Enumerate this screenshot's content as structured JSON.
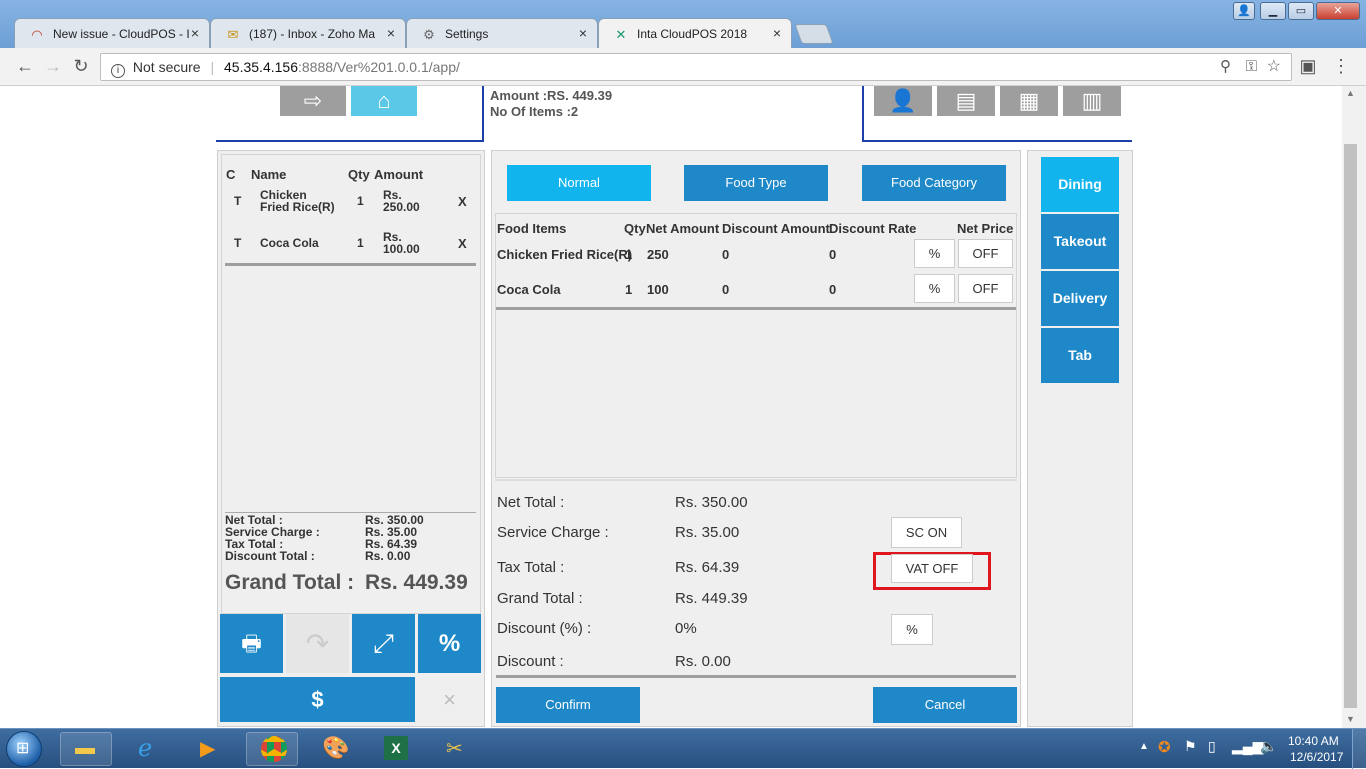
{
  "browser": {
    "tabs": [
      {
        "title": "New issue - CloudPOS - I",
        "icon": "cloudpos-icon"
      },
      {
        "title": "(187) - Inbox - Zoho Ma",
        "icon": "mail-icon"
      },
      {
        "title": "Settings",
        "icon": "gear-icon"
      },
      {
        "title": "Inta CloudPOS 2018",
        "icon": "inta-icon"
      }
    ],
    "security": "Not secure",
    "url_host": "45.35.4.156",
    "url_rest": ":8888/Ver%201.0.0.1/app/"
  },
  "header": {
    "amount": "Amount :RS. 449.39",
    "items": "No Of Items :2"
  },
  "order": {
    "headers": {
      "c": "C",
      "name": "Name",
      "qty": "Qty",
      "amount": "Amount"
    },
    "rows": [
      {
        "c": "T",
        "name1": "Chicken",
        "name2": "Fried Rice(R)",
        "qty": "1",
        "amt1": "Rs.",
        "amt2": "250.00",
        "x": "X"
      },
      {
        "c": "T",
        "name1": "Coca Cola",
        "name2": "",
        "qty": "1",
        "amt1": "Rs.",
        "amt2": "100.00",
        "x": "X"
      }
    ],
    "totals": {
      "net_label": "Net Total :",
      "net_value": "Rs. 350.00",
      "svc_label": "Service Charge :",
      "svc_value": "Rs. 35.00",
      "tax_label": "Tax Total :",
      "tax_value": "Rs. 64.39",
      "disc_label": "Discount Total :",
      "disc_value": "Rs. 0.00",
      "grand_label": "Grand Total :",
      "grand_value": "Rs. 449.39"
    },
    "percent_label": "%",
    "dollar_label": "$",
    "close_label": "×"
  },
  "middle": {
    "tabs": {
      "normal": "Normal",
      "food_type": "Food Type",
      "food_category": "Food Category"
    },
    "headers": {
      "items": "Food Items",
      "qty": "Qty",
      "net": "Net Amount",
      "disc": "Discount Amount",
      "rate": "Discount Rate",
      "price": "Net Price"
    },
    "rows": [
      {
        "name": "Chicken Fried Rice(R)",
        "qty": "1",
        "net": "250",
        "disc": "0",
        "rate": "0",
        "pct": "%",
        "off": "OFF"
      },
      {
        "name": "Coca Cola",
        "qty": "1",
        "net": "100",
        "disc": "0",
        "rate": "0",
        "pct": "%",
        "off": "OFF"
      }
    ],
    "summary": {
      "net_label": "Net Total :",
      "net_value": "Rs. 350.00",
      "svc_label": "Service Charge :",
      "svc_value": "Rs. 35.00",
      "sc_button": "SC ON",
      "tax_label": "Tax Total :",
      "tax_value": "Rs. 64.39",
      "vat_button": "VAT OFF",
      "grand_label": "Grand Total :",
      "grand_value": "Rs. 449.39",
      "discp_label": "Discount (%) :",
      "discp_value": "0%",
      "discp_button": "%",
      "disc_label": "Discount :",
      "disc_value": "Rs. 0.00"
    },
    "confirm": "Confirm",
    "cancel": "Cancel",
    "highlight_color": "#e0161f"
  },
  "right": {
    "dining": "Dining",
    "takeout": "Takeout",
    "delivery": "Delivery",
    "tab": "Tab"
  },
  "taskbar": {
    "time": "10:40 AM",
    "date": "12/6/2017"
  },
  "colors": {
    "primary_blue": "#1e88c8",
    "active_cyan": "#12b4ee"
  }
}
